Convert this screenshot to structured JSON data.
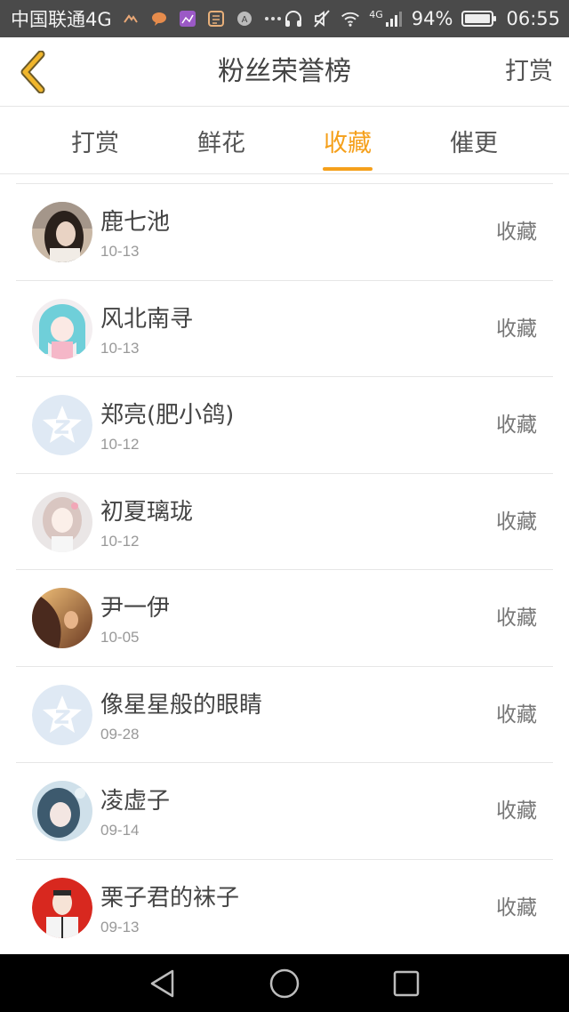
{
  "status_bar": {
    "carrier": "中国联通4G",
    "network_label": "4G",
    "battery": "94%",
    "time": "06:55"
  },
  "header": {
    "title": "粉丝荣誉榜",
    "action_label": "打赏"
  },
  "tabs": [
    {
      "label": "打赏",
      "active": false
    },
    {
      "label": "鲜花",
      "active": false
    },
    {
      "label": "收藏",
      "active": true
    },
    {
      "label": "催更",
      "active": false
    }
  ],
  "list": [
    {
      "name": "鹿七池",
      "date": "10-13",
      "action": "收藏",
      "avatar": "photo-girl"
    },
    {
      "name": "风北南寻",
      "date": "10-13",
      "action": "收藏",
      "avatar": "anime-blue-hair"
    },
    {
      "name": "郑亮(肥小鸽)",
      "date": "10-12",
      "action": "收藏",
      "avatar": "default-z"
    },
    {
      "name": "初夏璃珑",
      "date": "10-12",
      "action": "收藏",
      "avatar": "anime-pink"
    },
    {
      "name": "尹一伊",
      "date": "10-05",
      "action": "收藏",
      "avatar": "sunset-photo"
    },
    {
      "name": "像星星般的眼睛",
      "date": "09-28",
      "action": "收藏",
      "avatar": "default-z"
    },
    {
      "name": "凌虚子",
      "date": "09-14",
      "action": "收藏",
      "avatar": "anime-blue"
    },
    {
      "name": "栗子君的袜子",
      "date": "09-13",
      "action": "收藏",
      "avatar": "red-cartoon"
    }
  ],
  "colors": {
    "accent": "#f5a01b",
    "back_arrow": "#f0b62c",
    "default_avatar_bg": "#dfe9f4"
  }
}
